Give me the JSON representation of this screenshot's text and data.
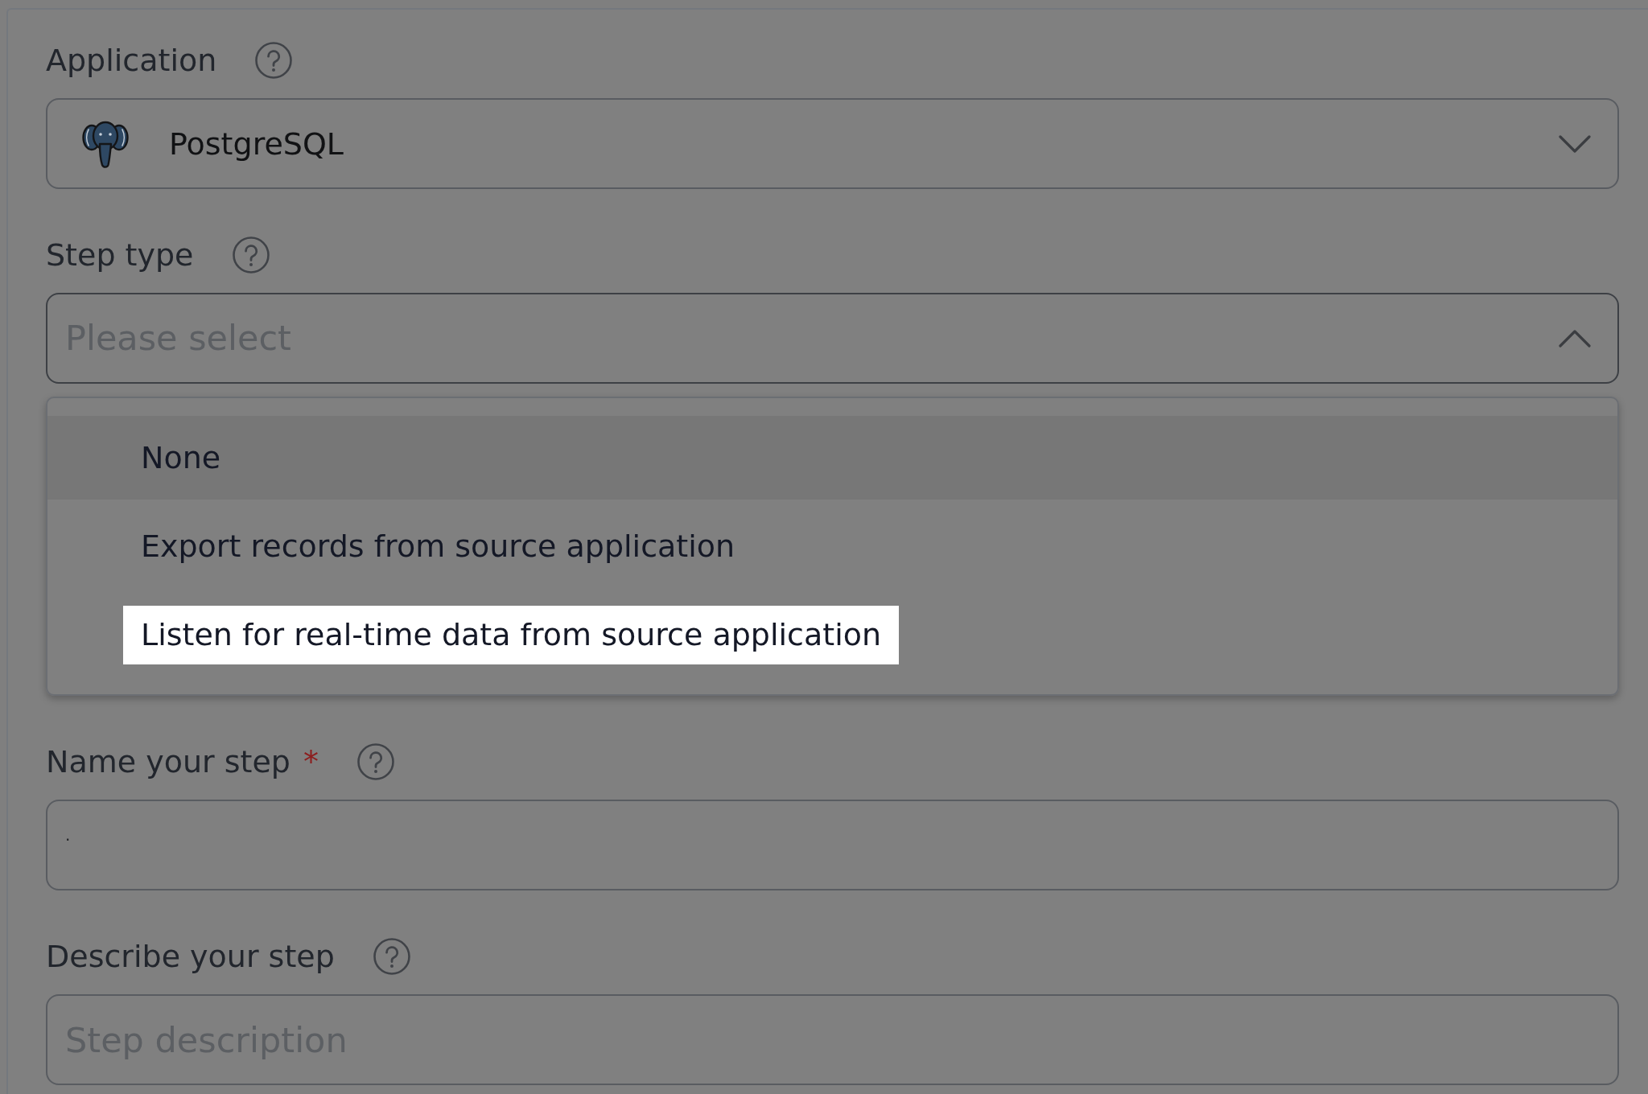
{
  "fields": [
    {
      "kind": "select",
      "label": "Application",
      "value": "PostgreSQL",
      "expanded": false
    },
    {
      "kind": "select",
      "label": "Step type",
      "placeholder": "Please select",
      "expanded": true,
      "options": [
        {
          "label": "None",
          "active": true,
          "spotlit": false
        },
        {
          "label": "Export records from source application",
          "active": false,
          "spotlit": false
        },
        {
          "label": "Listen for real-time data from source application",
          "active": false,
          "spotlit": true
        }
      ]
    },
    {
      "kind": "text",
      "label": "Name your step",
      "required_mark": "*",
      "value": "."
    },
    {
      "kind": "text",
      "label": "Describe your step",
      "placeholder": "Step description"
    }
  ]
}
